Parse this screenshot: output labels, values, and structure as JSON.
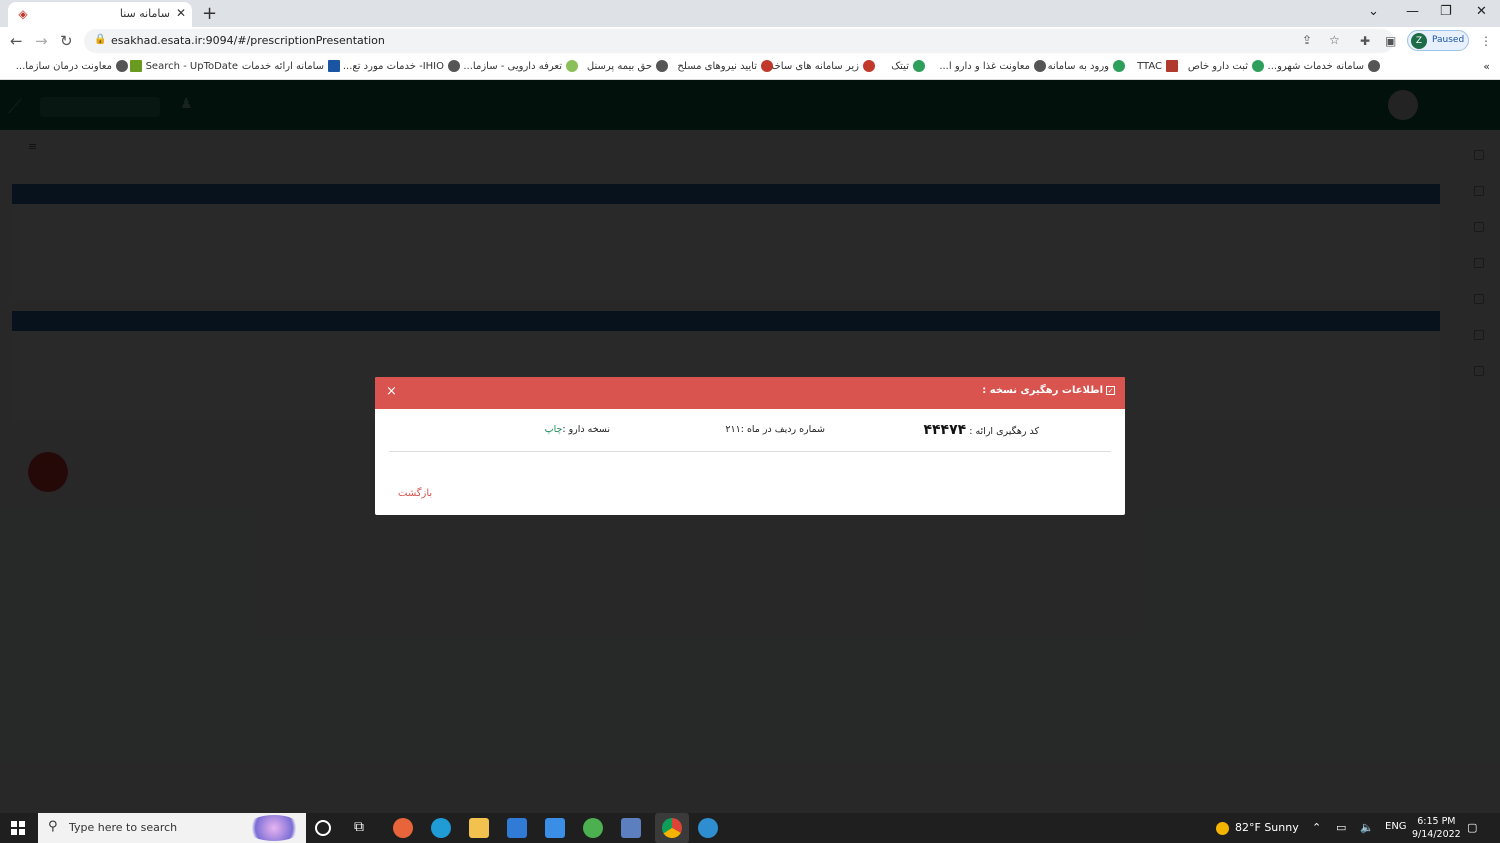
{
  "browser": {
    "tab_title": "سامانه سنا",
    "url": "esakhad.esata.ir:9094/#/prescriptionPresentation",
    "profile_initial": "Z",
    "profile_status": "Paused",
    "bookmarks": [
      "سامانه خدمات شهرو...",
      "ثبت دارو خاص",
      "TTAC",
      "ورود به سامانه",
      "معاونت غذا و دارو ا...",
      "تیتک",
      "زیر سامانه های ساخد",
      "تایید نیروهای مسلح",
      "حق بیمه پرسنل",
      "تعرفه دارویی - سازما...",
      "IHIO- خدمات مورد تع...",
      "سامانه ارائه خدمات",
      "Search - UpToDate",
      "معاونت درمان سازما..."
    ]
  },
  "modal": {
    "title": "اطلاعات رهگیری نسخه :",
    "tracking_label": "کد رهگیری ارائه :",
    "tracking_code": "۴۴۴۷۴",
    "row_number_label": "شماره ردیف در ماه :",
    "row_number_value": "۲۱۱",
    "prescription_label": "نسخه دارو :",
    "print_link": "چاپ",
    "back_link": "بازگشت",
    "close_symbol": "×"
  },
  "taskbar": {
    "search_placeholder": "Type here to search",
    "weather": "82°F  Sunny",
    "language": "ENG",
    "time": "6:15 PM",
    "date": "9/14/2022"
  },
  "colors": {
    "modal_header": "#d9534f",
    "app_header": "#0f6b4f",
    "print_link": "#1e8e5b",
    "section_bar": "#2d6fb3"
  }
}
